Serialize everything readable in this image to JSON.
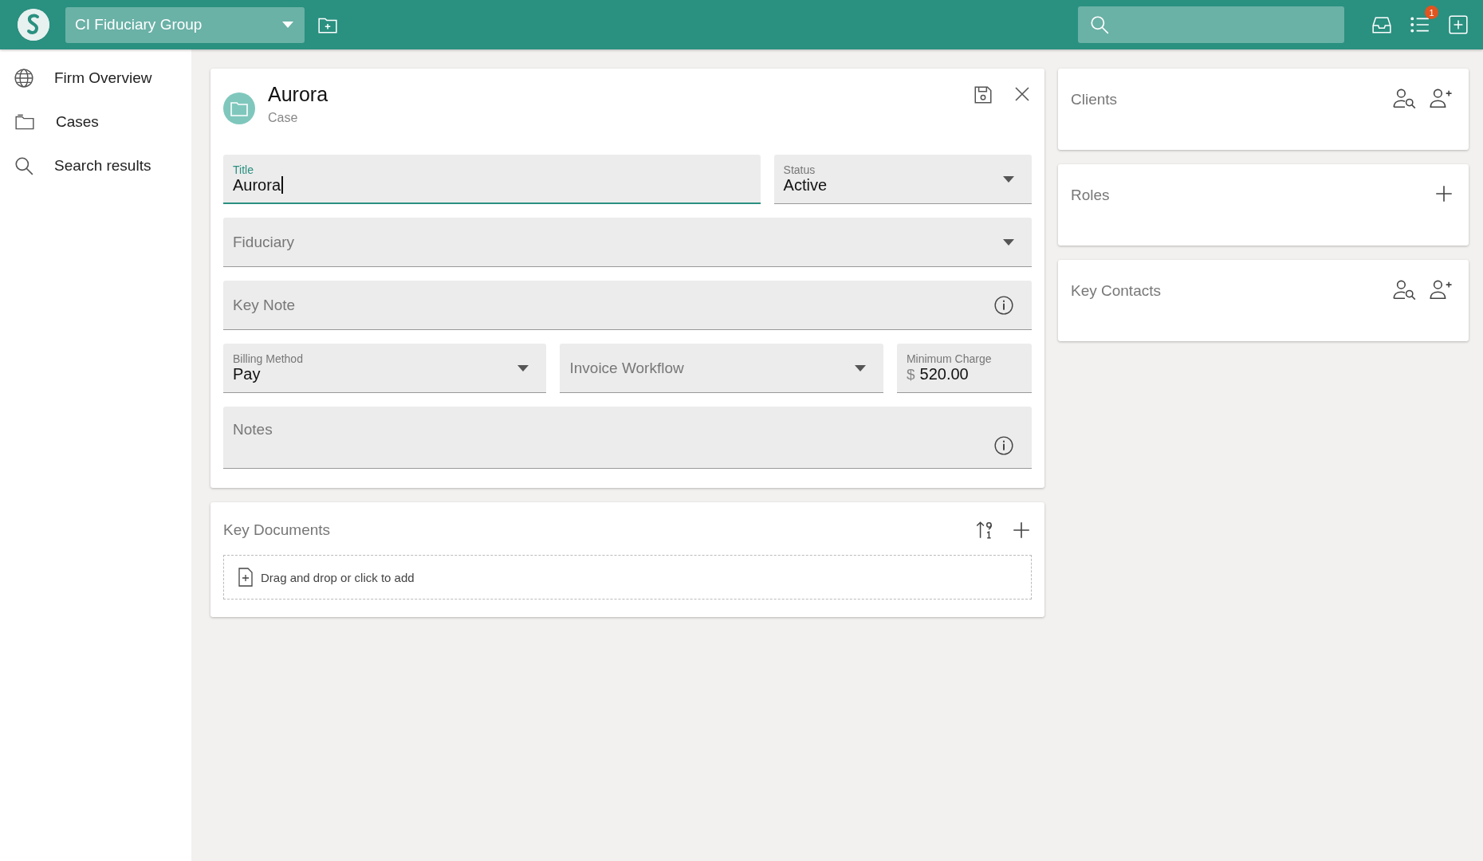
{
  "top_bar": {
    "org_selector": "CI Fiduciary Group",
    "notification_count": "1"
  },
  "sidebar": {
    "items": [
      {
        "label": "Firm Overview",
        "selected": false
      },
      {
        "label": "Cases",
        "selected": false
      },
      {
        "label": "Search results",
        "selected": false
      }
    ]
  },
  "case_card": {
    "title": "Aurora",
    "subtitle": "Case",
    "field_rows": [
      [
        {
          "kind": "text",
          "label": "Title",
          "value": "Aurora",
          "focused": true
        },
        {
          "kind": "select",
          "label": "Status",
          "value": "Active",
          "focused": false
        }
      ],
      [
        {
          "kind": "select",
          "label": "Fiduciary",
          "focused": false
        }
      ],
      [
        {
          "kind": "text",
          "label": "Key Note",
          "focused": false,
          "info": true
        }
      ],
      [
        {
          "kind": "select",
          "label": "Billing Method",
          "value": "Pay",
          "focused": false
        },
        {
          "kind": "select",
          "label": "Invoice Workflow",
          "focused": false
        },
        {
          "kind": "currency",
          "label": "Minimum Charge",
          "prefix": "$",
          "value": "520.00",
          "focused": false
        }
      ],
      [
        {
          "kind": "textarea",
          "label": "Notes",
          "focused": false,
          "info": true
        }
      ]
    ]
  },
  "key_documents": {
    "title": "Key Documents",
    "dropzone": "Drag and drop or click to add"
  },
  "side_panels": [
    {
      "title": "Clients"
    },
    {
      "title": "Roles"
    },
    {
      "title": "Key Contacts"
    }
  ]
}
